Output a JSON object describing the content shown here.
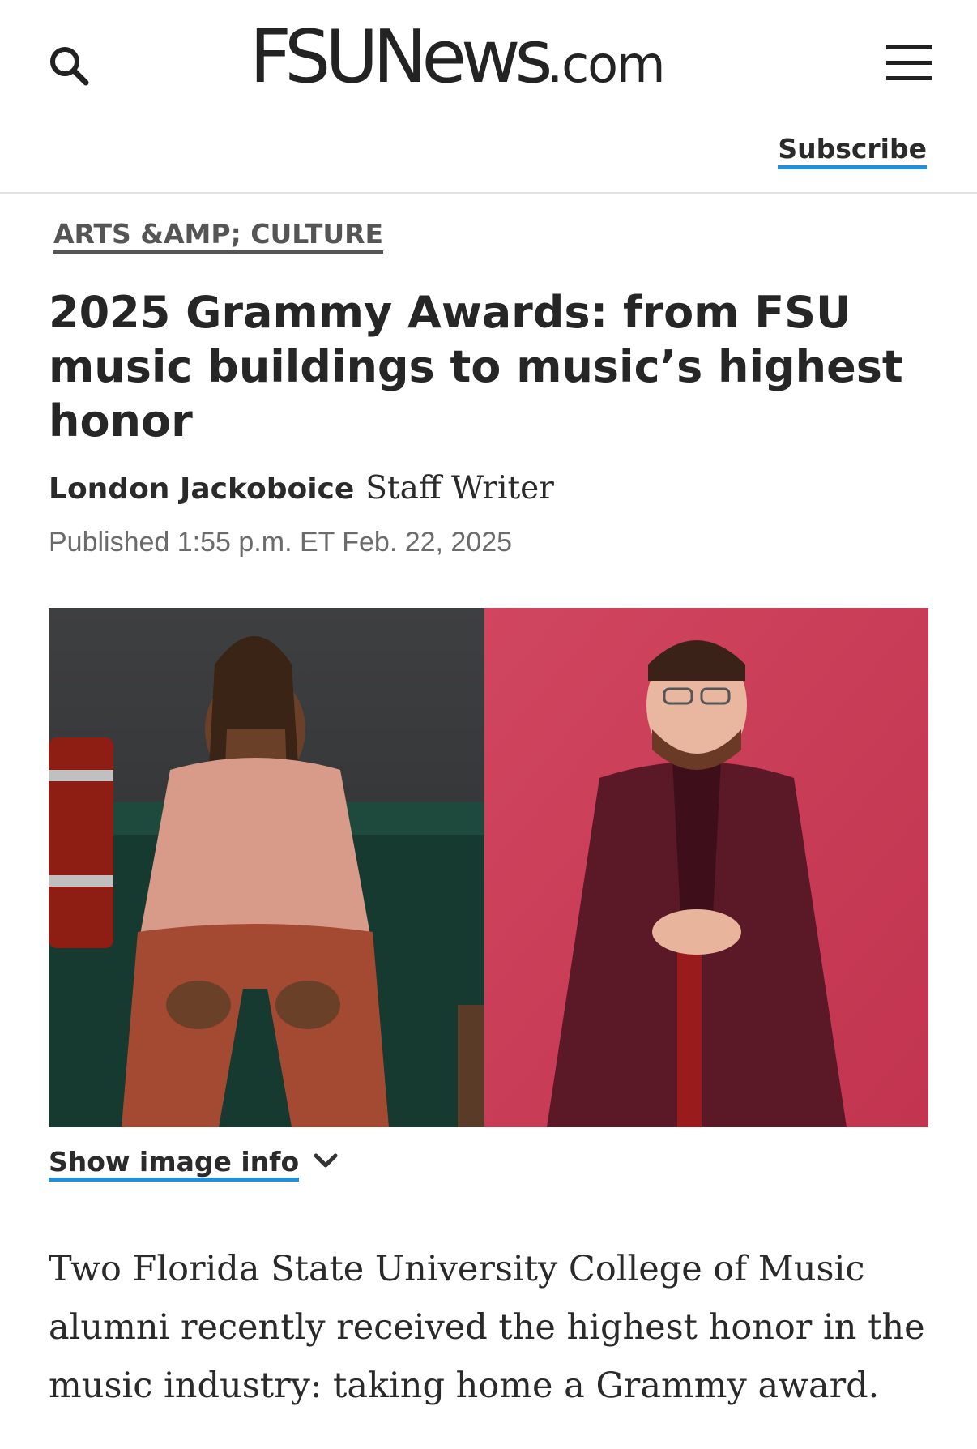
{
  "header": {
    "logo_main": "FSUNews",
    "logo_tld": ".com",
    "subscribe_label": "Subscribe"
  },
  "article": {
    "category": "ARTS &AMP; CULTURE",
    "headline": "2025 Grammy Awards: from FSU music buildings to music’s highest honor",
    "author": "London Jackoboice",
    "author_role": "Staff Writer",
    "published": "Published 1:55 p.m. ET Feb. 22, 2025",
    "image_info_label": "Show image info",
    "lede": "Two Florida State University College of Music alumni recently received the highest honor in the music industry: taking home a Grammy award."
  },
  "icons": {
    "search": "search-icon",
    "menu": "hamburger-menu-icon",
    "chevron": "chevron-down-icon"
  },
  "colors": {
    "accent": "#2190d8",
    "text": "#222222",
    "muted": "#6b6b6b",
    "photo_left_bg": "#3c3d3f",
    "photo_right_bg": "#c83d59"
  }
}
